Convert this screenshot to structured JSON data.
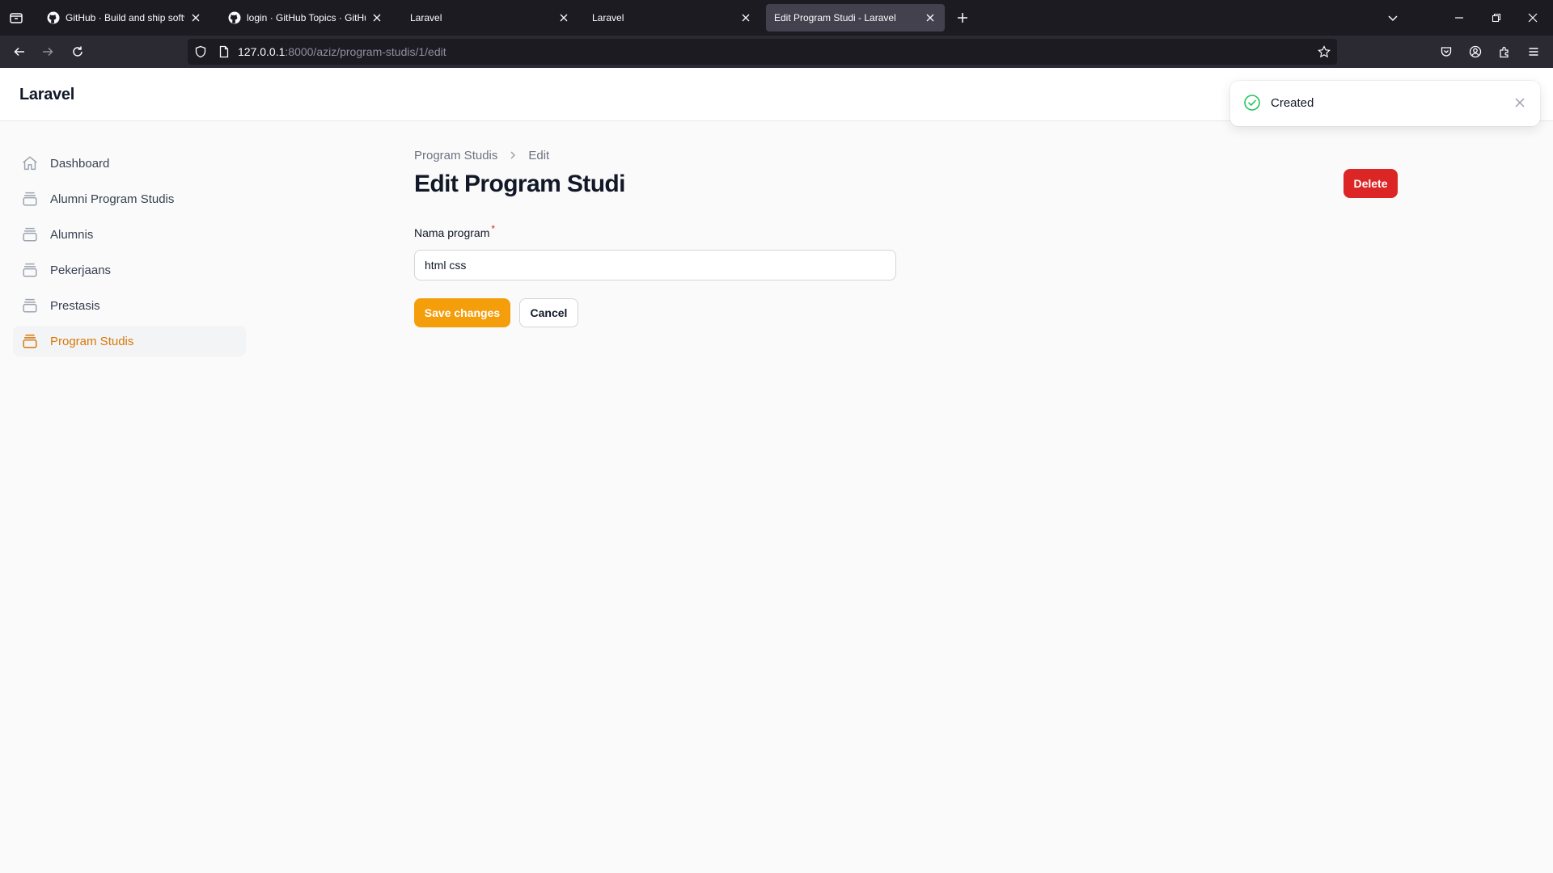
{
  "browser": {
    "tabs": [
      {
        "title": "GitHub · Build and ship software",
        "favicon": "github-icon",
        "active": false
      },
      {
        "title": "login · GitHub Topics · GitHub",
        "favicon": "github-icon",
        "active": false
      },
      {
        "title": "Laravel",
        "favicon": "",
        "active": false
      },
      {
        "title": "Laravel",
        "favicon": "",
        "active": false
      },
      {
        "title": "Edit Program Studi - Laravel",
        "favicon": "",
        "active": true
      }
    ],
    "url_host": "127.0.0.1",
    "url_rest": ":8000/aziz/program-studis/1/edit"
  },
  "app": {
    "brand": "Laravel"
  },
  "sidebar": {
    "items": [
      {
        "label": "Dashboard",
        "icon": "home-icon"
      },
      {
        "label": "Alumni Program Studis",
        "icon": "rectangle-stack-icon"
      },
      {
        "label": "Alumnis",
        "icon": "rectangle-stack-icon"
      },
      {
        "label": "Pekerjaans",
        "icon": "rectangle-stack-icon"
      },
      {
        "label": "Prestasis",
        "icon": "rectangle-stack-icon"
      },
      {
        "label": "Program Studis",
        "icon": "rectangle-stack-icon",
        "active": true
      }
    ]
  },
  "page": {
    "breadcrumbs": [
      "Program Studis",
      "Edit"
    ],
    "title": "Edit Program Studi",
    "delete_label": "Delete"
  },
  "form": {
    "field_label": "Nama program",
    "required_marker": "*",
    "field_value": "html css",
    "save_label": "Save changes",
    "cancel_label": "Cancel"
  },
  "toast": {
    "message": "Created"
  },
  "colors": {
    "primary": "#f59e0b",
    "danger": "#dc2626",
    "success": "#22c55e",
    "active_nav": "#d97706"
  }
}
